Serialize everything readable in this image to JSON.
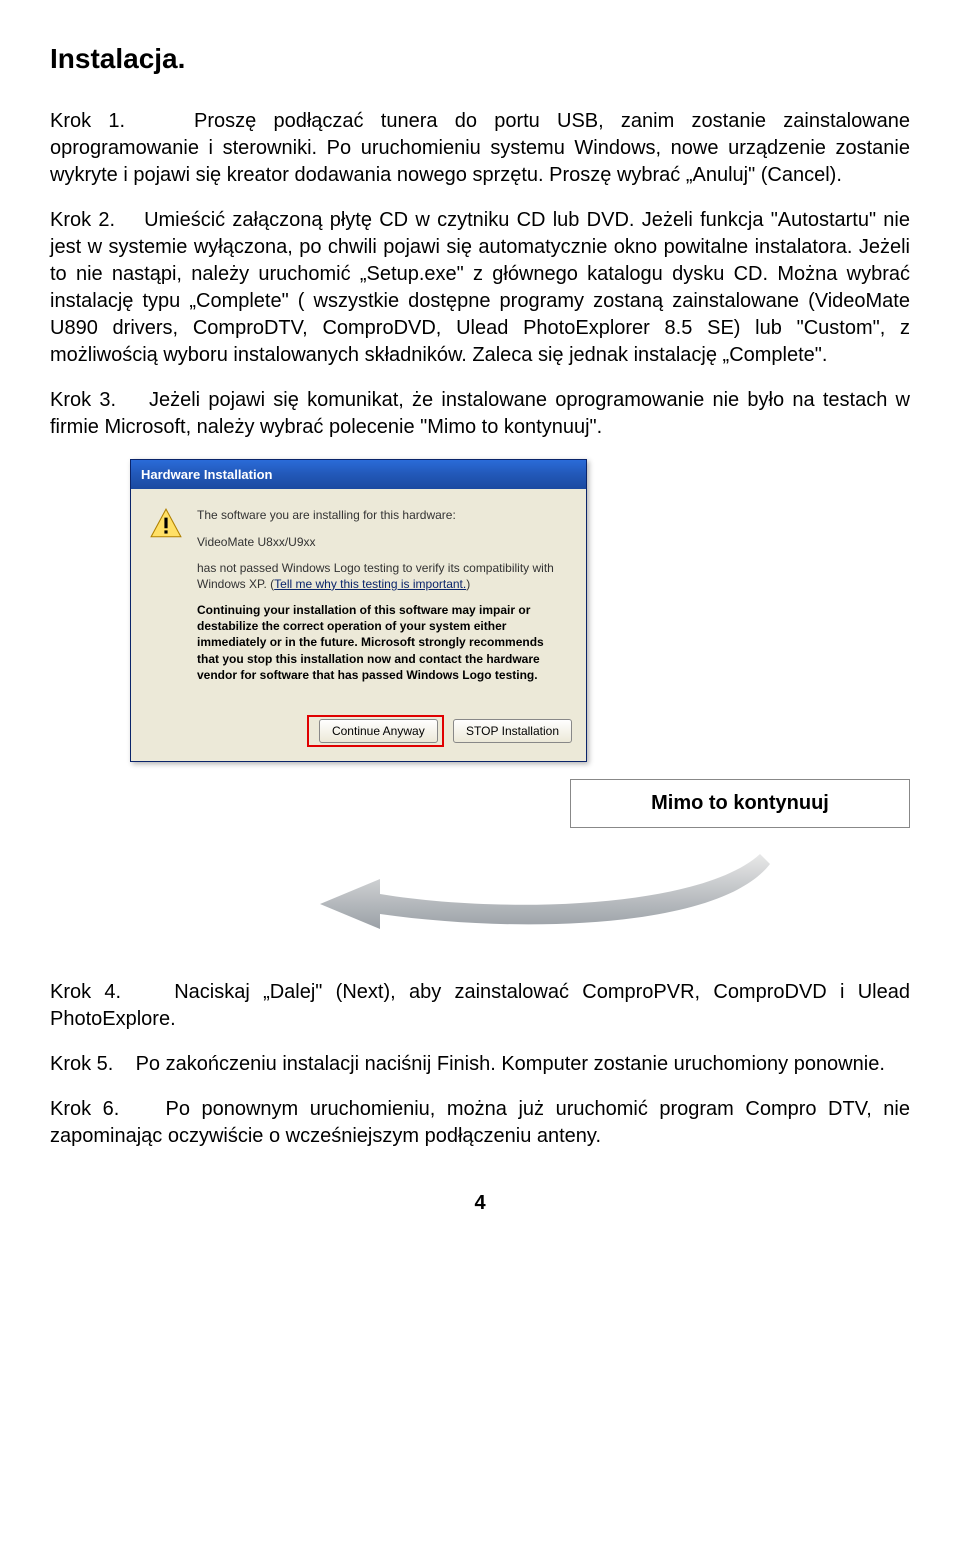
{
  "title": "Instalacja.",
  "paragraphs": {
    "k1": "Krok 1.    Proszę podłączać tunera do portu USB, zanim zostanie zainstalowane oprogramowanie i sterowniki. Po uruchomieniu systemu Windows, nowe urządzenie zostanie wykryte i pojawi się kreator dodawania nowego sprzętu. Proszę wybrać „Anuluj\" (Cancel).",
    "k2": "Krok 2.    Umieścić załączoną płytę CD w czytniku CD lub DVD. Jeżeli funkcja \"Autostartu\" nie jest w systemie wyłączona, po chwili pojawi się automatycznie okno powitalne instalatora. Jeżeli to nie nastąpi, należy uruchomić „Setup.exe\" z głównego katalogu dysku CD. Można wybrać instalację typu „Complete\" ( wszystkie dostępne programy zostaną zainstalowane (VideoMate U890 drivers, ComproDTV, ComproDVD, Ulead PhotoExplorer 8.5 SE) lub \"Custom\", z możliwością wyboru instalowanych składników. Zaleca się jednak instalację „Complete\".",
    "k3": "Krok 3.    Jeżeli pojawi się komunikat, że instalowane oprogramowanie nie było na testach w firmie Microsoft, należy wybrać polecenie \"Mimo to kontynuuj\".",
    "k4": "Krok 4.    Naciskaj „Dalej\" (Next), aby zainstalować ComproPVR, ComproDVD i Ulead PhotoExplore.",
    "k5": "Krok 5.    Po zakończeniu instalacji naciśnij Finish. Komputer zostanie uruchomiony ponownie.",
    "k6": "Krok 6.    Po ponownym uruchomieniu, można już uruchomić program Compro DTV, nie zapominając oczywiście o wcześniejszym podłączeniu anteny."
  },
  "dialog": {
    "title": "Hardware Installation",
    "line1": "The software you are installing for this hardware:",
    "device": "VideoMate U8xx/U9xx",
    "line2a": "has not passed Windows Logo testing to verify its compatibility with Windows XP. (",
    "link": "Tell me why this testing is important.",
    "line2b": ")",
    "bold": "Continuing your installation of this software may impair or destabilize the correct operation of your system either immediately or in the future. Microsoft strongly recommends that you stop this installation now and contact the hardware vendor for software that has passed Windows Logo testing.",
    "btn_continue": "Continue Anyway",
    "btn_stop": "STOP Installation"
  },
  "callout": "Mimo to kontynuuj",
  "page_number": "4"
}
